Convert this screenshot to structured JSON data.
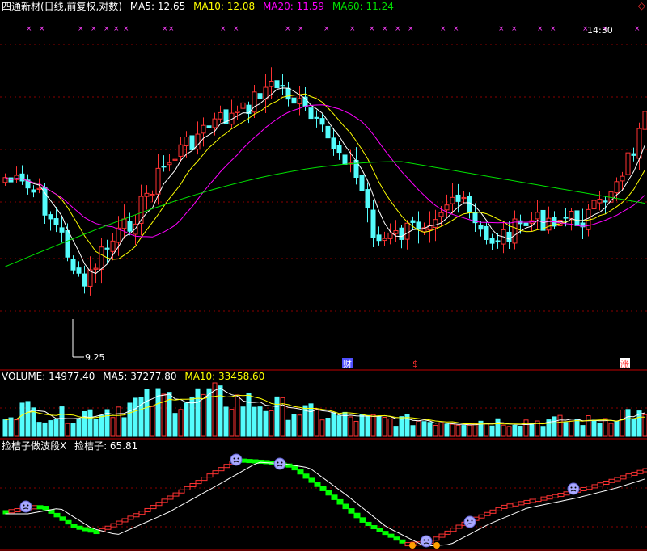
{
  "header_main": {
    "title": "四通新材(日线,前复权,对数)",
    "ma5": "MA5: 12.65",
    "ma10": "MA10: 12.08",
    "ma20": "MA20: 11.59",
    "ma60": "MA60: 11.24"
  },
  "header_volume": {
    "title": "VOLUME: 14977.40",
    "ma5": "MA5: 37277.80",
    "ma10": "MA10: 33458.60"
  },
  "header_indicator": {
    "title": "捡桔子做波段X",
    "value": "捡桔子: 65.81"
  },
  "corner_icon": "diamond-icon",
  "annotations": {
    "time_label": "14:30",
    "low_label": "9.25",
    "markers": [
      "财",
      "$",
      "涨"
    ]
  },
  "colors": {
    "up": "#ff3232",
    "down": "#54fcfc",
    "ma5": "#ffffff",
    "ma10": "#ffff00",
    "ma20": "#ff00ff",
    "ma60": "#00e000",
    "signal": "#ff40ff",
    "indicator_green": "#00ff00",
    "face": "#a8a8ff"
  },
  "chart_data": [
    {
      "type": "candlestick",
      "scale": "log",
      "price_marks": {
        "low": 9.25
      },
      "series_colors": {
        "MA5": "#ffffff",
        "MA10": "#ffff00",
        "MA20": "#ff00ff",
        "MA60": "#00e000"
      }
    },
    {
      "type": "bar",
      "name": "VOLUME",
      "values": {
        "last": 14977.4,
        "MA5": 37277.8,
        "MA10": 33458.6
      }
    },
    {
      "type": "line",
      "name": "捡桔子",
      "values": {
        "last": 65.81
      }
    }
  ]
}
